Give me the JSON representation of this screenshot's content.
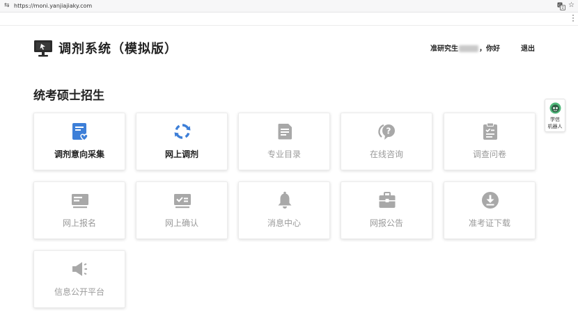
{
  "browser": {
    "url": "https://moni.yanjiajiaky.com"
  },
  "header": {
    "title": "调剂系统（模拟版）",
    "greeting_prefix": "准研究生",
    "greeting_suffix": "，你好",
    "logout": "退出"
  },
  "section": {
    "title": "统考硕士招生"
  },
  "colors": {
    "active_blue": "#3d7fd8",
    "disabled_gray": "#a8a8a8"
  },
  "cards": [
    {
      "label": "调剂意向采集",
      "icon": "document-heart-icon",
      "active": true
    },
    {
      "label": "网上调剂",
      "icon": "refresh-icon",
      "active": true
    },
    {
      "label": "专业目录",
      "icon": "catalog-icon",
      "active": false
    },
    {
      "label": "在线咨询",
      "icon": "question-chat-icon",
      "active": false
    },
    {
      "label": "调查问卷",
      "icon": "clipboard-check-icon",
      "active": false
    },
    {
      "label": "网上报名",
      "icon": "register-card-icon",
      "active": false
    },
    {
      "label": "网上确认",
      "icon": "confirm-screen-icon",
      "active": false
    },
    {
      "label": "消息中心",
      "icon": "bell-icon",
      "active": false
    },
    {
      "label": "网报公告",
      "icon": "announcement-bag-icon",
      "active": false
    },
    {
      "label": "准考证下载",
      "icon": "download-icon",
      "active": false
    },
    {
      "label": "信息公开平台",
      "icon": "megaphone-icon",
      "active": false
    }
  ],
  "robot": {
    "line1": "学信",
    "line2": "机器人"
  }
}
